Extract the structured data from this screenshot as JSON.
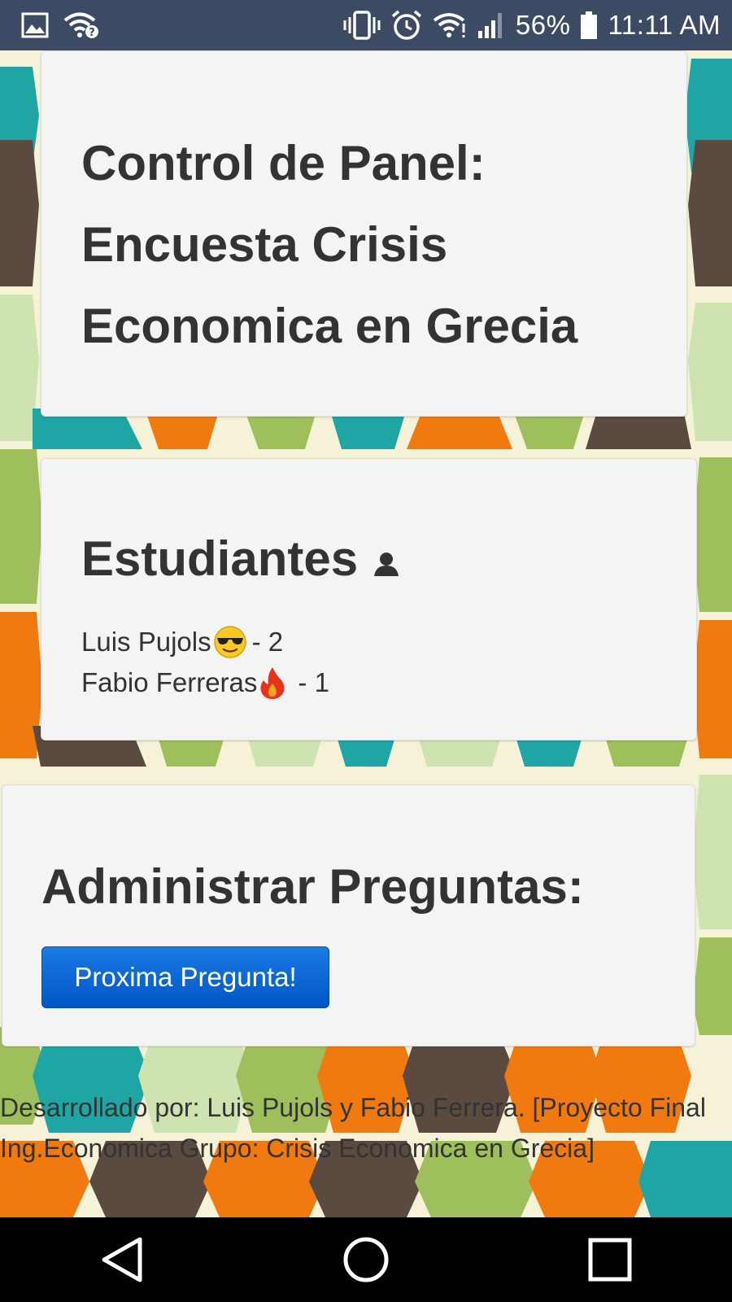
{
  "status_bar": {
    "battery": "56%",
    "time": "11:11 AM",
    "icons": [
      "image-icon",
      "wifi-question-icon",
      "vibrate-icon",
      "alarm-icon",
      "wifi-icon",
      "signal-icon",
      "battery-icon"
    ]
  },
  "header_card": {
    "title": "Control de Panel: Encuesta Crisis Economica en Grecia"
  },
  "students": {
    "heading": "Estudiantes",
    "icon": "user-icon",
    "items": [
      {
        "name": "Luis Pujols",
        "emoji": "sunglasses-emoji",
        "score": "- 2"
      },
      {
        "name": "Fabio Ferreras",
        "emoji": "fire-emoji",
        "score": "- 1"
      }
    ]
  },
  "admin": {
    "heading": "Administrar Preguntas:",
    "button_label": "Proxima Pregunta!"
  },
  "footer": {
    "text": "Desarrollado por: Luis Pujols y Fabio Ferrera. [Proyecto Final Ing.Economica Grupo: Crisis Economica en Grecia]"
  },
  "nav": {
    "icons": [
      "back-icon",
      "home-icon",
      "recents-icon"
    ]
  },
  "colors": {
    "status_bar": "#3d4a63",
    "button": "#0a66d6",
    "teal": "#1fa6a4",
    "orange": "#f07a10",
    "green": "#9fbf5c",
    "brown": "#5a4a40"
  }
}
